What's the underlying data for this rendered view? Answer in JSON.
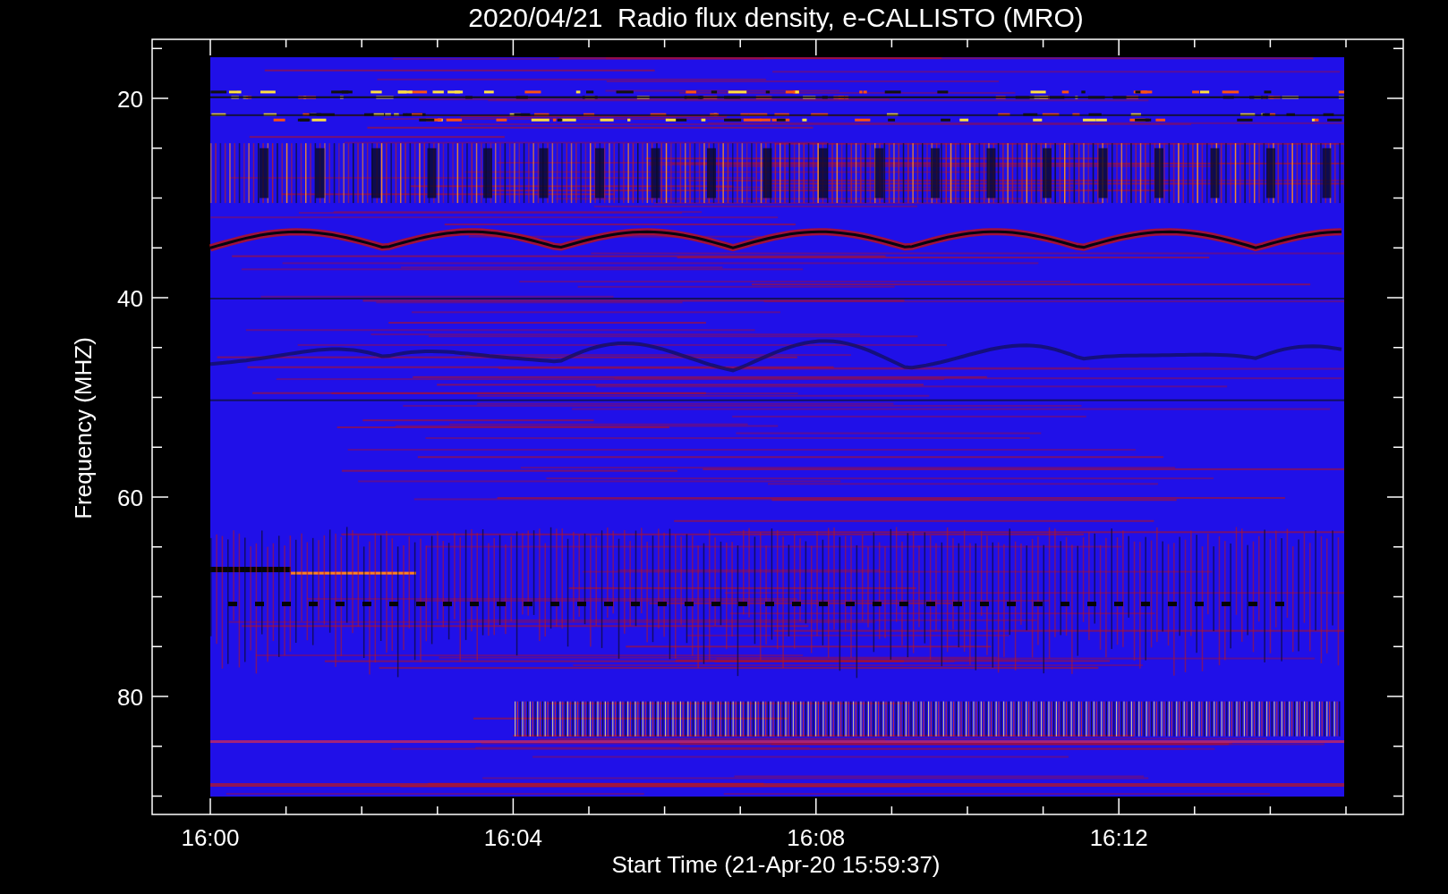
{
  "plot": {
    "title": "2020/04/21  Radio flux density, e-CALLISTO (MRO)",
    "xlabel": "Start Time (21-Apr-20 15:59:37)",
    "ylabel": "Frequency (MHZ)",
    "xticks": [
      "16:00",
      "16:04",
      "16:08",
      "16:12"
    ],
    "yticks": [
      "20",
      "40",
      "60",
      "80"
    ]
  }
}
